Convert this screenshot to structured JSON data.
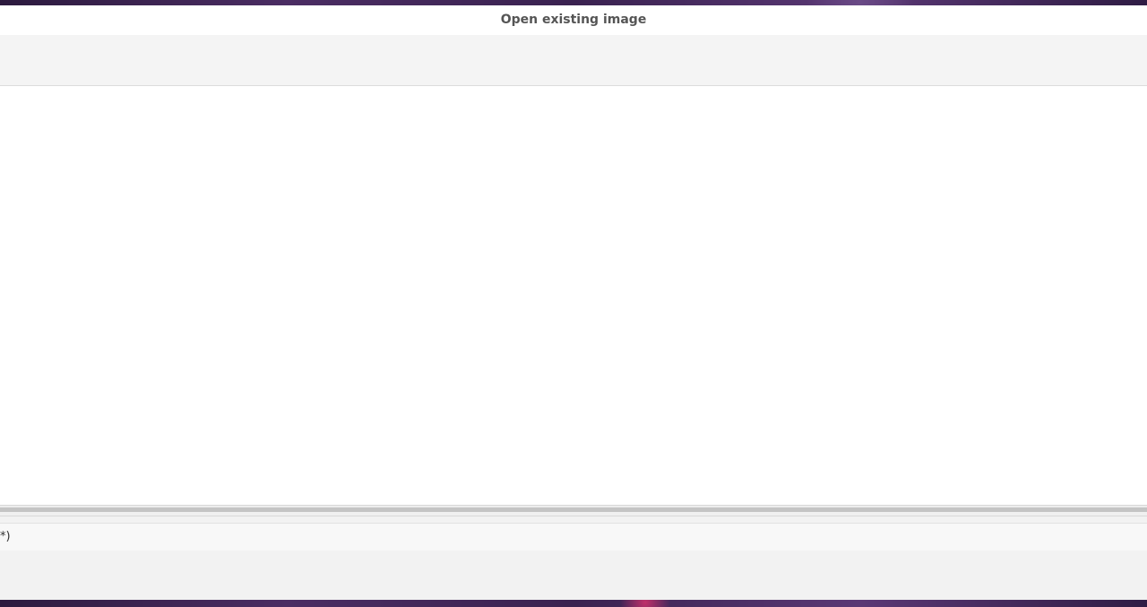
{
  "window": {
    "title": "Open existing image"
  },
  "file_type_filter": {
    "visible_text": "*)"
  },
  "colors": {
    "titlebar_bg": "#ffffff",
    "title_text": "#555555",
    "panel_bg": "#f2f2f2",
    "file_list_bg": "#ffffff",
    "pane_handle": "#c4c4c4"
  }
}
